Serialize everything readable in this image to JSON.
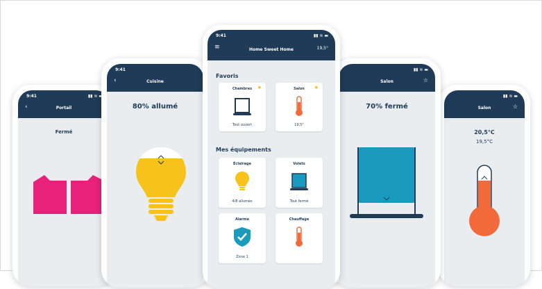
{
  "colors": {
    "navy": "#1f3b57",
    "screen_bg": "#e9edf0",
    "pink": "#e8227a",
    "yellow": "#f7c21b",
    "blue": "#1a9bbd",
    "orange": "#f26a3a",
    "star": "#f5b400"
  },
  "phone_far_left": {
    "time": "9:41",
    "title": "Portail",
    "status": "Fermé",
    "icon": "gate-icon"
  },
  "phone_left": {
    "time": "9:41",
    "title": "Cuisine",
    "status": "80% allumé",
    "icon": "lightbulb-icon",
    "level_percent": 80
  },
  "phone_center": {
    "time": "9:41",
    "title": "Home Sweet Home",
    "temp": "19,5°",
    "favorites_title": "Favoris",
    "favorites": [
      {
        "label": "Chambres",
        "value": "Tout ouvert",
        "icon": "shutter-icon",
        "starred": true
      },
      {
        "label": "Salon",
        "value": "19,5°",
        "icon": "thermometer-icon",
        "starred": true
      }
    ],
    "equipment_title": "Mes équipements",
    "equipment": [
      {
        "label": "Éclairage",
        "value": "4/8 allumés",
        "icon": "lightbulb-icon"
      },
      {
        "label": "Volets",
        "value": "Tout fermé",
        "icon": "shutter-icon"
      },
      {
        "label": "Alarme",
        "value": "Zone 1",
        "icon": "shield-check-icon"
      },
      {
        "label": "Chauffage",
        "value": "",
        "icon": "thermometer-icon"
      }
    ]
  },
  "phone_right": {
    "time": "9:41",
    "title": "Salon",
    "status": "70% fermé",
    "icon": "shutter-icon",
    "level_percent": 70
  },
  "phone_far_right": {
    "time": "9:41",
    "title": "Salon",
    "temp": "20,5°C",
    "target": "19,5°C",
    "icon": "thermometer-icon"
  }
}
